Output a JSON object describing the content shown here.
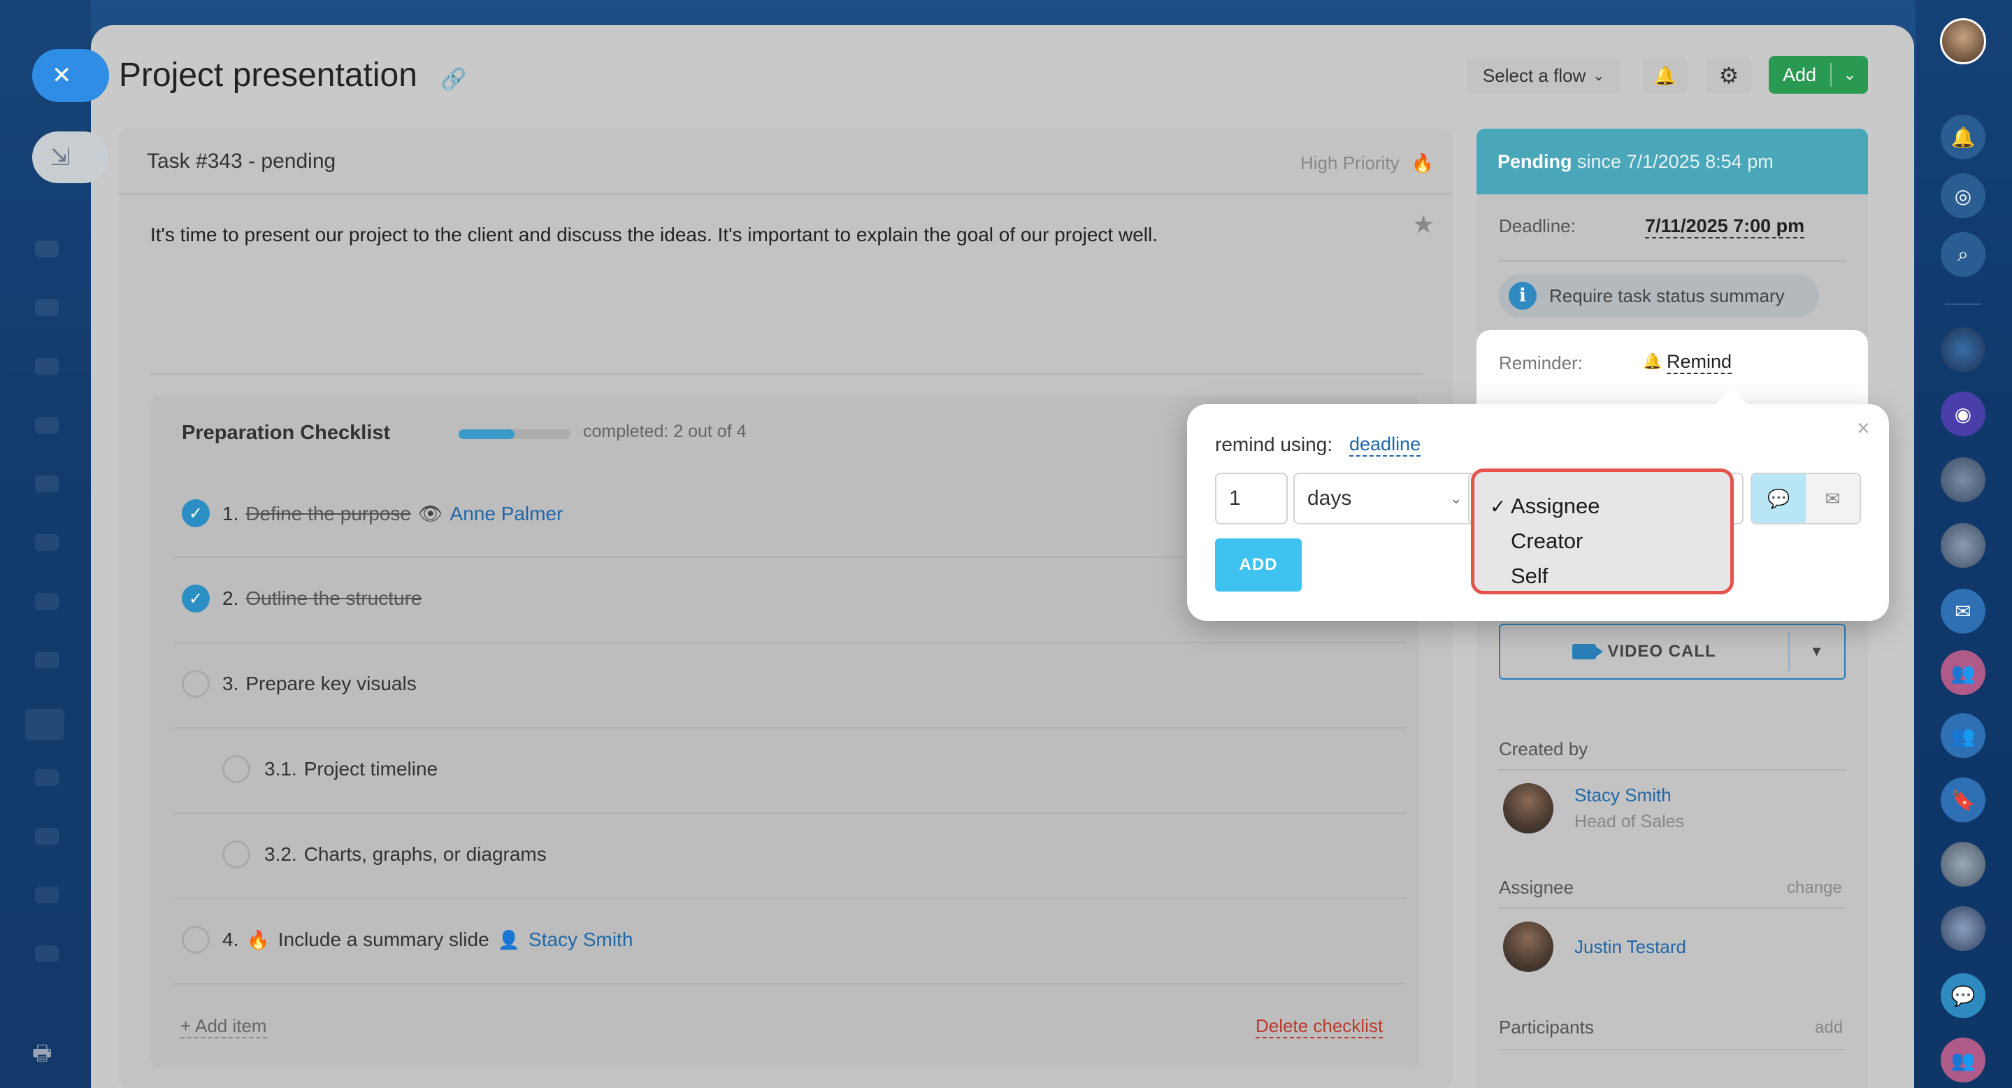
{
  "header": {
    "title": "Project presentation",
    "flow_select": "Select a flow",
    "add_label": "Add"
  },
  "task": {
    "title": "Task #343 - pending",
    "priority": "High Priority",
    "description": "It's time to present our project to the client and discuss the ideas. It's important to explain the goal of our project well."
  },
  "checklist": {
    "title": "Preparation Checklist",
    "progress_text": "completed: 2 out of 4",
    "progress_fraction": 0.5,
    "items": [
      {
        "num": "1.",
        "text": "Define the purpose",
        "done": true,
        "person": "Anne Palmer"
      },
      {
        "num": "2.",
        "text": "Outline the structure",
        "done": true
      },
      {
        "num": "3.",
        "text": "Prepare key visuals",
        "done": false
      },
      {
        "num": "3.1.",
        "text": "Project timeline",
        "done": false
      },
      {
        "num": "3.2.",
        "text": "Charts, graphs, or diagrams",
        "done": false
      },
      {
        "num": "4.",
        "text": "Include a summary slide",
        "done": false,
        "person": "Stacy Smith"
      }
    ],
    "add_item": "+ Add item",
    "delete": "Delete checklist"
  },
  "sidebar": {
    "status_label": "Pending",
    "status_since": "since 7/1/2025 8:54 pm",
    "deadline_label": "Deadline:",
    "deadline_value": "7/11/2025 7:00 pm",
    "summary_pill": "Require task status summary",
    "reminder_label": "Reminder:",
    "remind_link": "Remind",
    "video_call": "VIDEO CALL",
    "created_by_label": "Created by",
    "creator_name": "Stacy Smith",
    "creator_role": "Head of Sales",
    "assignee_label": "Assignee",
    "assignee_action": "change",
    "assignee_name": "Justin Testard",
    "participants_label": "Participants",
    "participants_action": "add"
  },
  "popup": {
    "remind_using_label": "remind using:",
    "remind_using_value": "deadline",
    "amount_value": "1",
    "unit_value": "days",
    "add_button": "ADD",
    "recipient_options": [
      "Assignee",
      "Creator",
      "Self"
    ],
    "selected_recipient": "Assignee"
  },
  "colors": {
    "accent_blue": "#2f8de6",
    "add_green": "#2a9a52",
    "status_teal": "#49a7b9",
    "highlight_red": "#e5534b",
    "popup_add": "#3ec3f0"
  }
}
